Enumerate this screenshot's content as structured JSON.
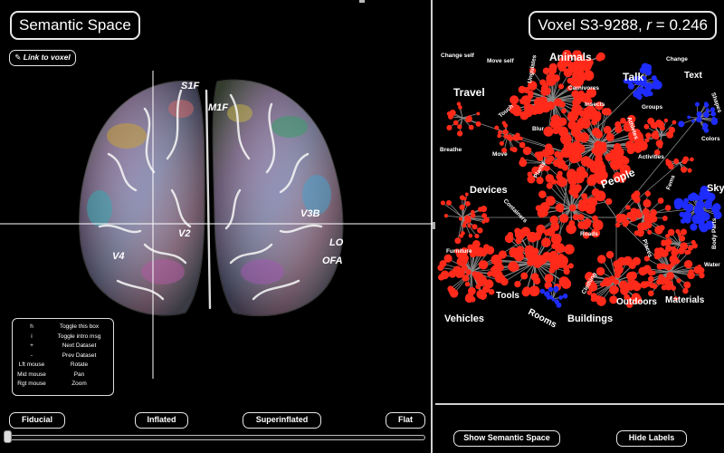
{
  "left": {
    "title": "Semantic Space",
    "link_to_voxel": "Link to voxel",
    "link_icon": "pencil-icon",
    "roi_labels": [
      "S1F",
      "M1F",
      "V3B",
      "V2",
      "V4",
      "LO",
      "OFA"
    ],
    "help": [
      {
        "key": "h",
        "desc": "Toggle this box"
      },
      {
        "key": "i",
        "desc": "Toggle intro msg"
      },
      {
        "key": "+",
        "desc": "Next Dataset"
      },
      {
        "key": "-",
        "desc": "Prev Dataset"
      },
      {
        "key": "Lft mouse",
        "desc": "Rotate"
      },
      {
        "key": "Mid mouse",
        "desc": "Pan"
      },
      {
        "key": "Rgt mouse",
        "desc": "Zoom"
      }
    ],
    "buttons": {
      "fiducial": "Fiducial",
      "inflated": "Inflated",
      "superinflated": "Superinflated",
      "flat": "Flat"
    },
    "slider_value": 0
  },
  "right": {
    "title": "Voxel S3-9288, r = 0.246",
    "title_prefix": "Voxel S3-9288, ",
    "title_r": "r",
    "title_suffix": " = 0.246",
    "big_labels": [
      "Animals",
      "Travel",
      "Talk",
      "Text",
      "People",
      "Devices",
      "Sky",
      "Vehicles",
      "Tools",
      "Rooms",
      "Buildings",
      "Outdoors",
      "Materials"
    ],
    "small_labels": [
      "Change self",
      "Move self",
      "Change",
      "Ungulates",
      "Carnivores",
      "Touch",
      "Insects",
      "Blur",
      "Breathe",
      "Move",
      "Plants",
      "Furniture",
      "Containers",
      "Roads",
      "Groups",
      "Activities",
      "Colors",
      "Shapes",
      "Fems",
      "Body Parts",
      "Water",
      "Places",
      "Clothing",
      "Athletes"
    ],
    "show_semantic_space": "Show Semantic Space",
    "hide_labels": "Hide Labels"
  },
  "colors": {
    "background": "#000000",
    "border": "#e6e6e6",
    "positive": "#ff2a1a",
    "negative": "#1e2cff",
    "tree_line": "#8a8a8a"
  }
}
